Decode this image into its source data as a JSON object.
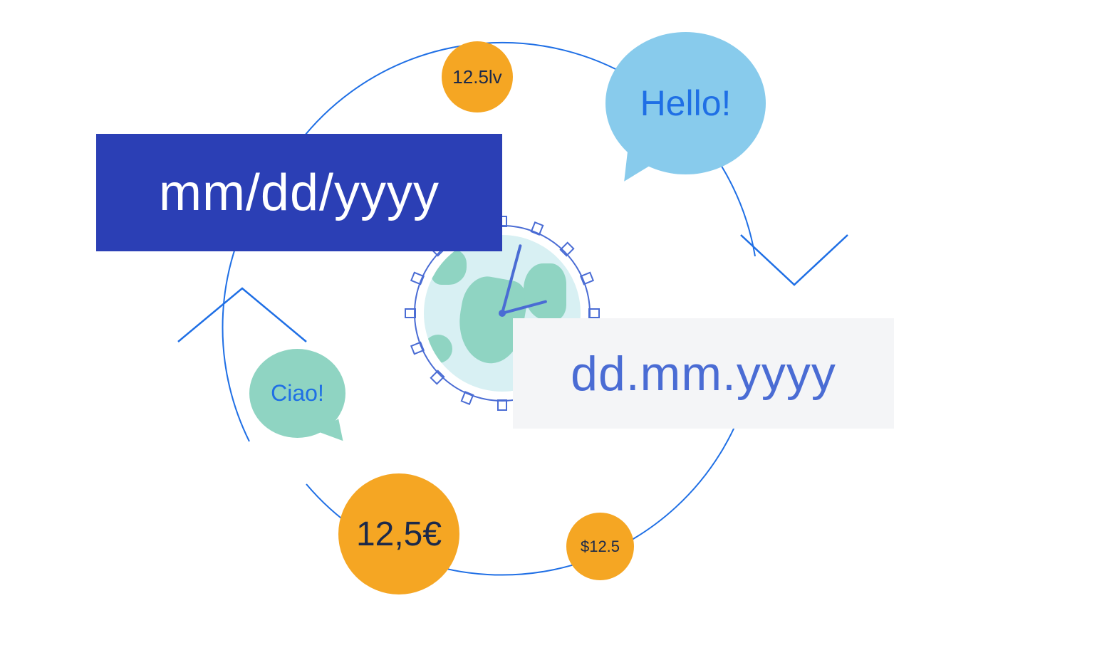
{
  "diagram": {
    "date_formats": {
      "primary_label": "mm/dd/yyyy",
      "secondary_label": "dd.mm.yyyy"
    },
    "greetings": {
      "english": "Hello!",
      "italian": "Ciao!"
    },
    "currencies": {
      "lev": "12.5lv",
      "euro": "12,5€",
      "dollar": "$12.5"
    },
    "colors": {
      "primary_box": "#2b3fb5",
      "secondary_box": "#f4f5f7",
      "accent_blue": "#4a6cd4",
      "coin": "#f5a623",
      "bubble_light_blue": "#88cbec",
      "bubble_teal": "#8fd4c2",
      "globe_water": "#d8f0f3",
      "globe_land": "#8fd4c2"
    }
  }
}
